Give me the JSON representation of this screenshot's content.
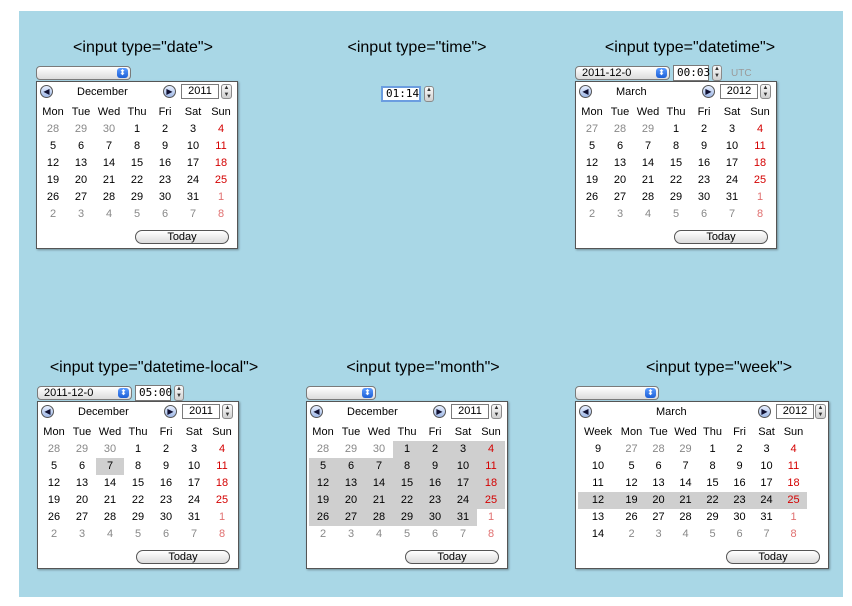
{
  "titles": {
    "date": "<input type=\"date\">",
    "time": "<input type=\"time\">",
    "datetime": "<input type=\"datetime\">",
    "datetime_local": "<input type=\"datetime-local\">",
    "month": "<input type=\"month\">",
    "week": "<input type=\"week\">"
  },
  "time_input": {
    "value": "01:14"
  },
  "datetime_input": {
    "date": "2011-12-0",
    "time": "00:03",
    "tz": "UTC"
  },
  "datetime_local_input": {
    "date": "2011-12-0",
    "time": "05:00"
  },
  "weekday_headers": [
    "Mon",
    "Tue",
    "Wed",
    "Thu",
    "Fri",
    "Sat",
    "Sun"
  ],
  "week_header": "Week",
  "today_label": "Today",
  "calendars": {
    "december_2011": {
      "month": "December",
      "year": "2011",
      "rows": [
        [
          "28",
          "29",
          "30",
          "1",
          "2",
          "3",
          "4"
        ],
        [
          "5",
          "6",
          "7",
          "8",
          "9",
          "10",
          "11"
        ],
        [
          "12",
          "13",
          "14",
          "15",
          "16",
          "17",
          "18"
        ],
        [
          "19",
          "20",
          "21",
          "22",
          "23",
          "24",
          "25"
        ],
        [
          "26",
          "27",
          "28",
          "29",
          "30",
          "31",
          "1"
        ],
        [
          "2",
          "3",
          "4",
          "5",
          "6",
          "7",
          "8"
        ]
      ]
    },
    "march_2012": {
      "month": "March",
      "year": "2012",
      "rows": [
        [
          "27",
          "28",
          "29",
          "1",
          "2",
          "3",
          "4"
        ],
        [
          "5",
          "6",
          "7",
          "8",
          "9",
          "10",
          "11"
        ],
        [
          "12",
          "13",
          "14",
          "15",
          "16",
          "17",
          "18"
        ],
        [
          "19",
          "20",
          "21",
          "22",
          "23",
          "24",
          "25"
        ],
        [
          "26",
          "27",
          "28",
          "29",
          "30",
          "31",
          "1"
        ],
        [
          "2",
          "3",
          "4",
          "5",
          "6",
          "7",
          "8"
        ]
      ],
      "weeks": [
        "9",
        "10",
        "11",
        "12",
        "13",
        "14"
      ]
    }
  }
}
